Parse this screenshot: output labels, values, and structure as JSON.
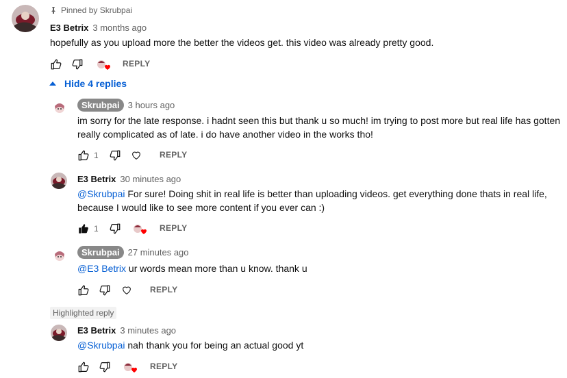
{
  "pinned": {
    "label": "Pinned by Skrubpai"
  },
  "comments": [
    {
      "author": "E3 Betrix",
      "time": "3 months ago",
      "text": "hopefully as you upload more the better the videos get. this video was already pretty good.",
      "reply_label": "REPLY"
    }
  ],
  "toggle": {
    "label": "Hide 4 replies"
  },
  "replies": [
    {
      "author": "Skrubpai",
      "time": "3 hours ago",
      "text_line1": "im sorry for the late response. i hadnt seen this but thank u so much! im trying to post more but real life has gotten",
      "text_line2": "really complicated as of late. i do have another video in the works tho!",
      "like_count": "1",
      "reply_label": "REPLY"
    },
    {
      "author": "E3 Betrix",
      "time": "30 minutes ago",
      "mention": "@Skrubpai",
      "text_line1": " For sure! Doing shit in real life is better than uploading videos. get everything done thats in real life,",
      "text_line2": "because I would like to see more content if you ever can :)",
      "like_count": "1",
      "reply_label": "REPLY"
    },
    {
      "author": "Skrubpai",
      "time": "27 minutes ago",
      "mention": "@E3 Betrix",
      "text": " ur words mean more than u know. thank u",
      "reply_label": "REPLY"
    },
    {
      "highlight_label": "Highlighted reply",
      "author": "E3 Betrix",
      "time": "3 minutes ago",
      "mention": "@Skrubpai",
      "text": " nah thank you for being an actual good yt",
      "reply_label": "REPLY"
    }
  ],
  "colors": {
    "link": "#065fd4",
    "heart": "#ff0000",
    "secondary_text": "#606060"
  },
  "icons": [
    "pin-icon",
    "like-icon",
    "dislike-icon",
    "heart-icon",
    "creator-heart-icon",
    "caret-up-icon"
  ]
}
